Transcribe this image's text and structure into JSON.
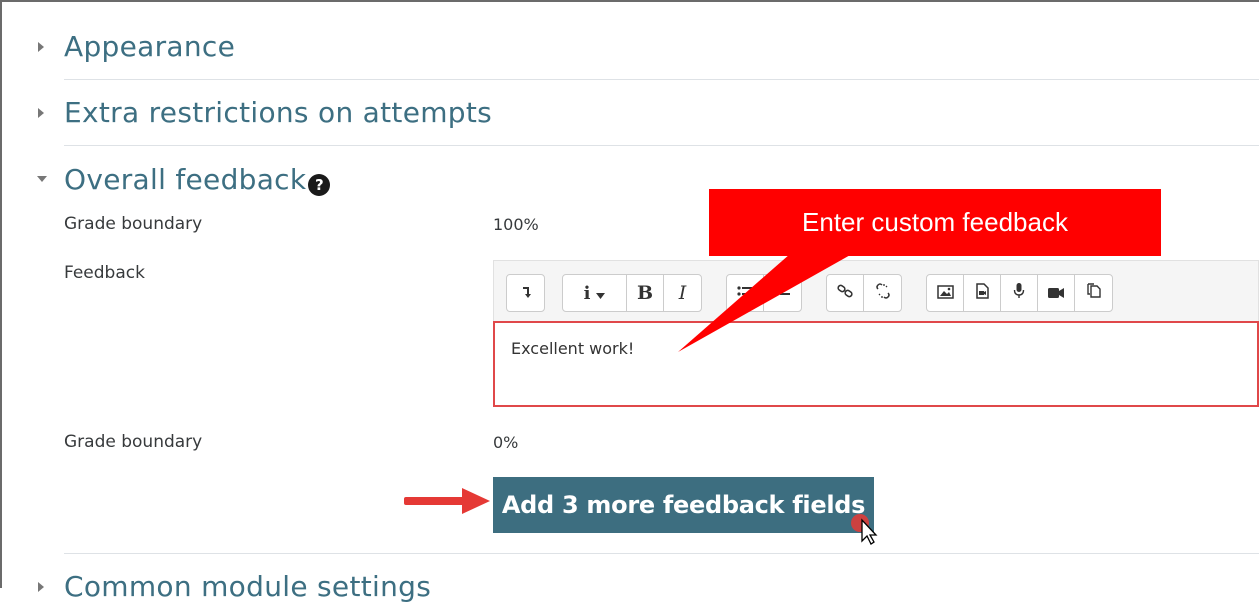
{
  "sections": {
    "appearance": "Appearance",
    "extra_restrictions": "Extra restrictions on attempts",
    "overall_feedback": "Overall feedback",
    "common_module_settings": "Common module settings"
  },
  "overall_feedback": {
    "help_icon": "question-circle-icon",
    "grade_boundary_label_1": "Grade boundary",
    "grade_boundary_value_1": "100%",
    "feedback_label": "Feedback",
    "feedback_text": "Excellent work!",
    "grade_boundary_label_2": "Grade boundary",
    "grade_boundary_value_2": "0%",
    "add_button_label": "Add 3 more feedback fields"
  },
  "toolbar": {
    "italic_glyph": "I",
    "bold_glyph": "B",
    "info_glyph": "i"
  },
  "annotation": {
    "callout_text": "Enter custom feedback",
    "callout_color": "#ff0000"
  },
  "colors": {
    "accent": "#3d6e80",
    "heading": "#3d6f82",
    "editor_border": "#e0484a"
  }
}
